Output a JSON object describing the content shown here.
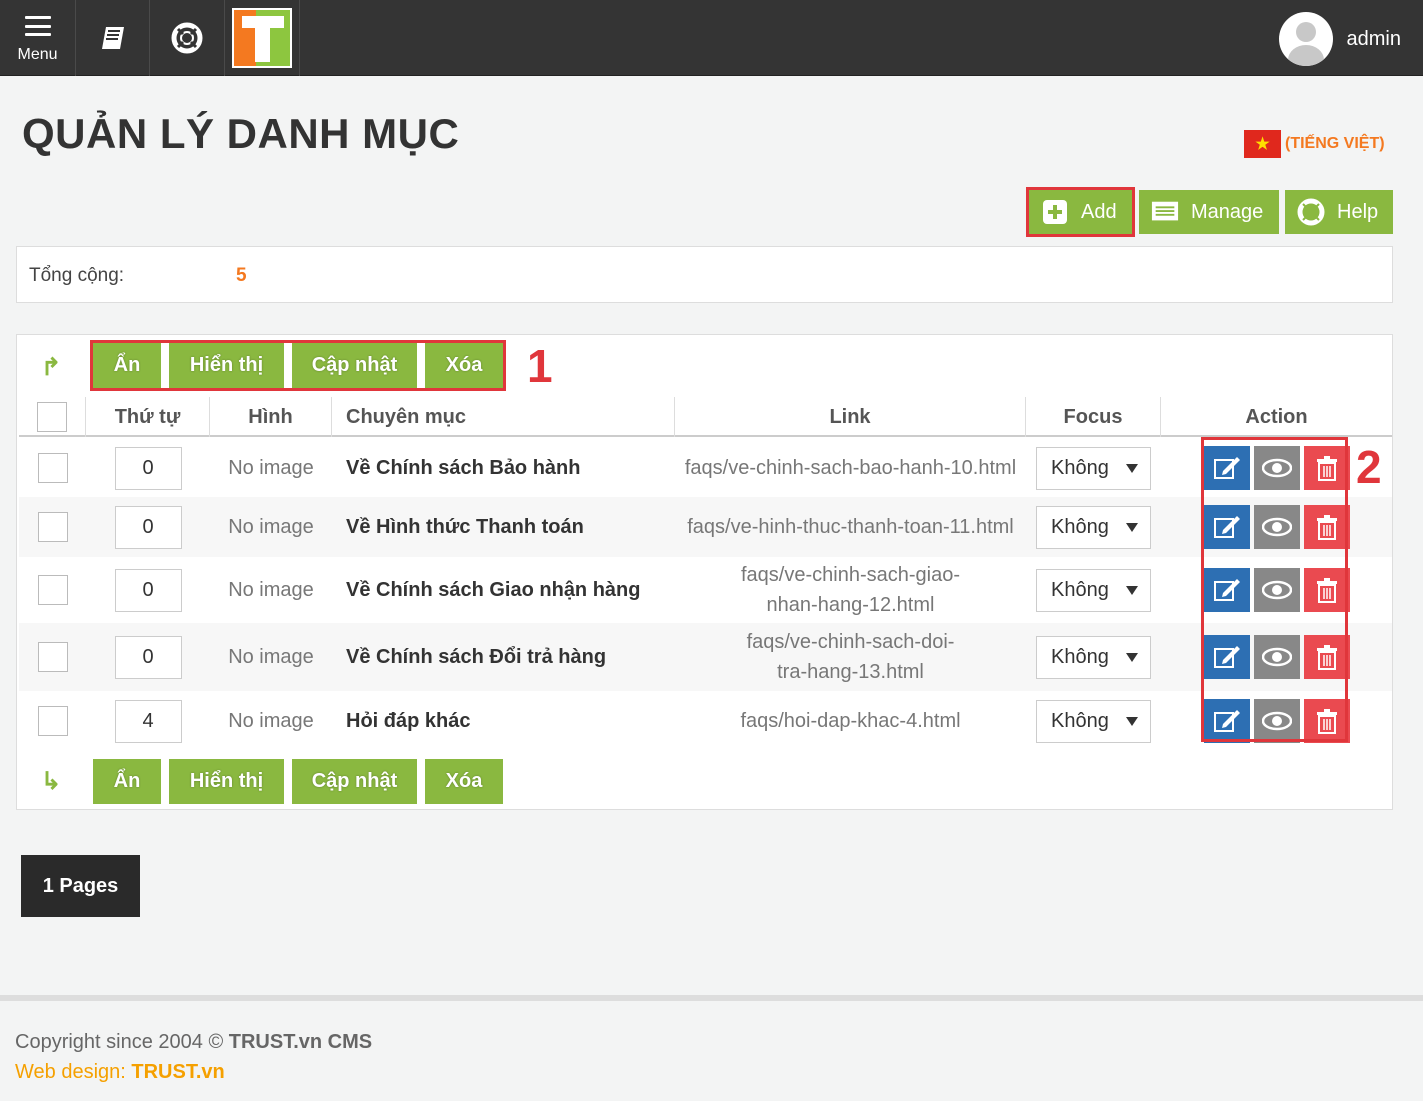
{
  "topbar": {
    "menu_label": "Menu",
    "user_name": "admin"
  },
  "page": {
    "title": "QUẢN LÝ DANH MỤC",
    "language": "(TIẾNG VIỆT)"
  },
  "toolbar": {
    "add_label": "Add",
    "manage_label": "Manage",
    "help_label": "Help"
  },
  "summary": {
    "total_label": "Tổng cộng:",
    "total_value": "5"
  },
  "bulk_actions": {
    "hide": "Ẩn",
    "show": "Hiển thị",
    "update": "Cập nhật",
    "delete": "Xóa"
  },
  "markers": {
    "one": "1",
    "two": "2"
  },
  "table": {
    "headers": {
      "order": "Thứ tự",
      "image": "Hình",
      "category": "Chuyên mục",
      "link": "Link",
      "focus": "Focus",
      "action": "Action"
    },
    "rows": [
      {
        "order": "0",
        "image": "No image",
        "category": "Về Chính sách Bảo hành",
        "link": "faqs/ve-chinh-sach-bao-hanh-10.html",
        "focus": "Không"
      },
      {
        "order": "0",
        "image": "No image",
        "category": "Về Hình thức Thanh toán",
        "link": "faqs/ve-hinh-thuc-thanh-toan-11.html",
        "focus": "Không"
      },
      {
        "order": "0",
        "image": "No image",
        "category": "Về Chính sách Giao nhận hàng",
        "link": "faqs/ve-chinh-sach-giao-nhan-hang-12.html",
        "focus": "Không"
      },
      {
        "order": "0",
        "image": "No image",
        "category": "Về Chính sách Đổi trả hàng",
        "link": "faqs/ve-chinh-sach-doi-tra-hang-13.html",
        "focus": "Không"
      },
      {
        "order": "4",
        "image": "No image",
        "category": "Hỏi đáp khác",
        "link": "faqs/hoi-dap-khac-4.html",
        "focus": "Không"
      }
    ]
  },
  "pagination": {
    "label": "1 Pages"
  },
  "footer": {
    "copyright_prefix": "Copyright since 2004 ©",
    "copyright_brand": "TRUST.vn CMS",
    "webdesign_prefix": "Web design:",
    "webdesign_brand": "TRUST.vn"
  },
  "colors": {
    "accent_green": "#8ab840",
    "highlight_red": "#e0363b",
    "edit_blue": "#2d6fb3",
    "delete_red": "#ea4a50",
    "brand_orange": "#f47920"
  }
}
